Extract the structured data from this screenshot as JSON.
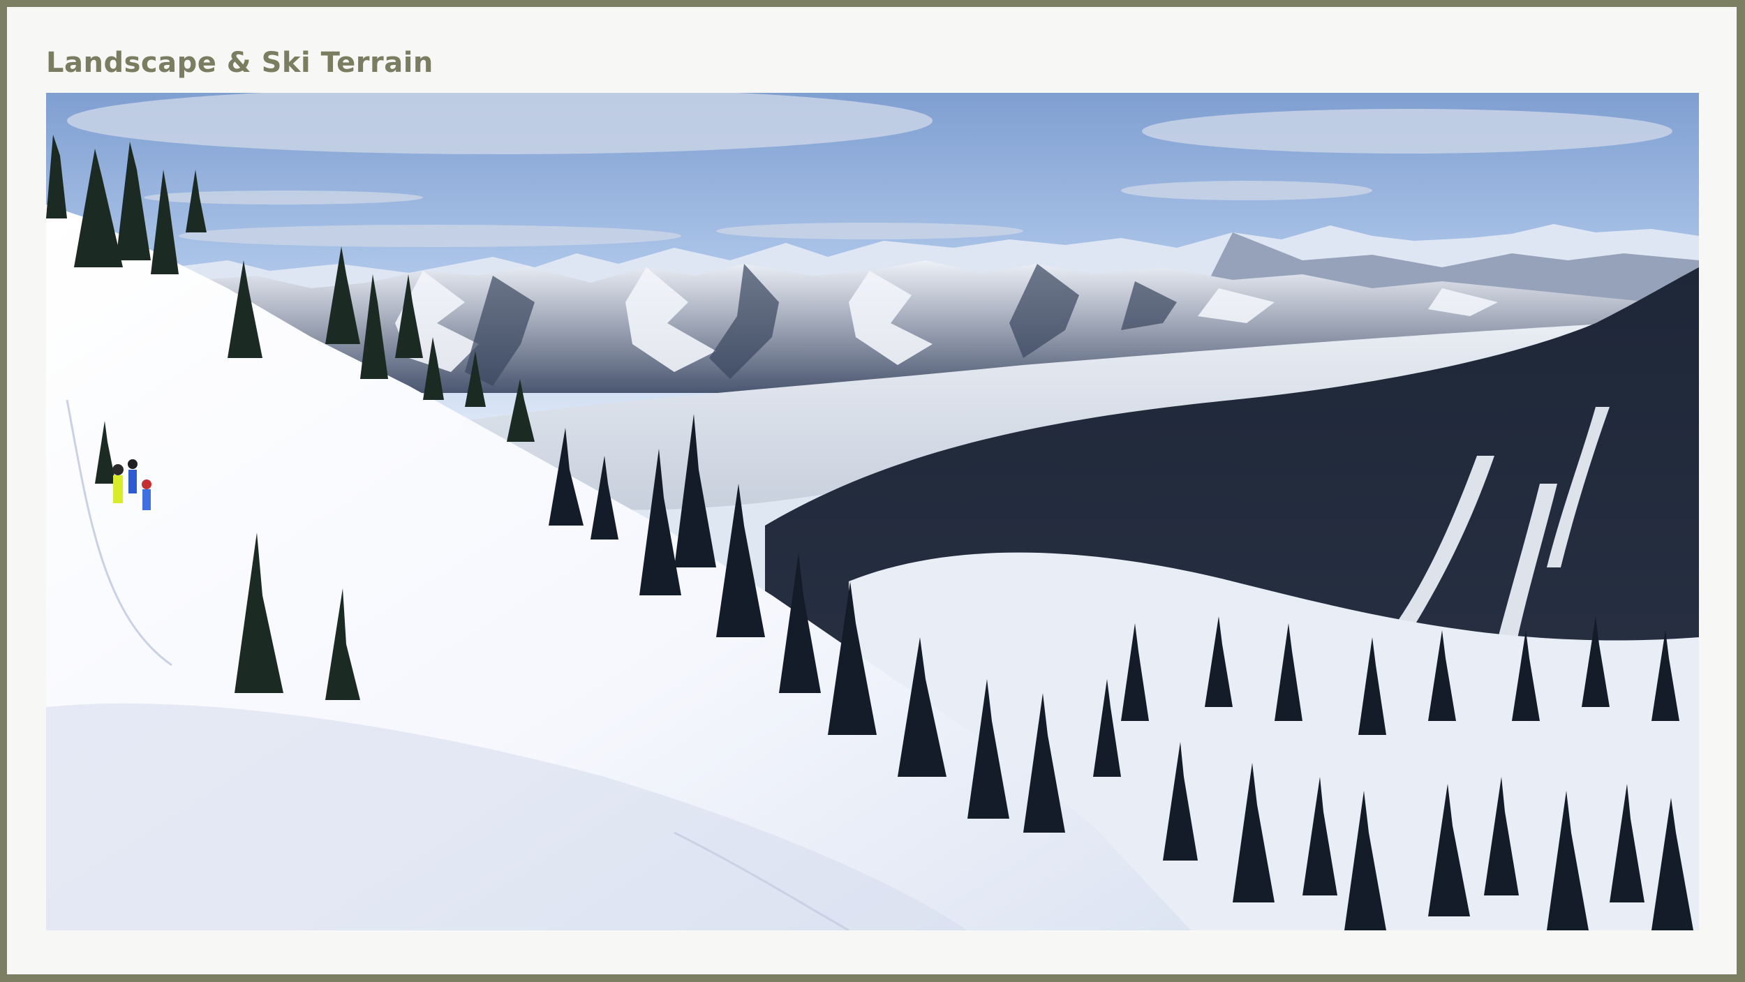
{
  "slide": {
    "title": "Landscape & Ski Terrain"
  },
  "photo": {
    "subject": "snowy mountain slope with skiers overlooking a cloud-filled valley and distant peaks",
    "icon": "landscape-photo-icon"
  },
  "colors": {
    "outer_frame": "#7c7f62",
    "page_background": "#f7f7f5",
    "title_text": "#7a7d5f",
    "sky_top": "#7f9fd1",
    "snow": "#f7f8fd",
    "forest": "#172033"
  }
}
